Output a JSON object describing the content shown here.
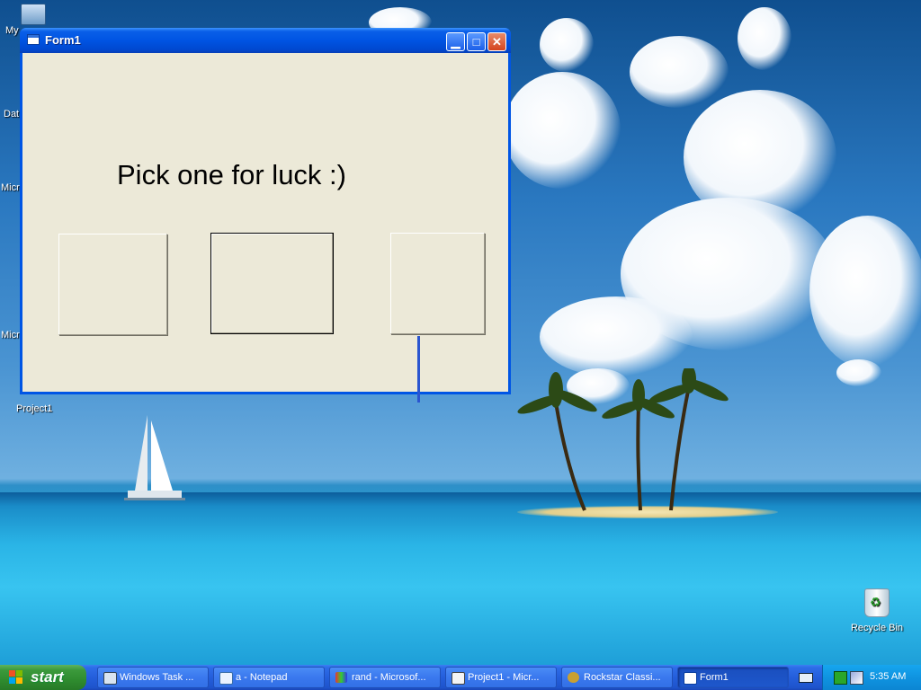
{
  "desktop": {
    "icons": [
      "My",
      "Dat",
      "Micr",
      "Micr",
      "Project1"
    ],
    "recycle_bin": "Recycle Bin"
  },
  "window": {
    "title": "Form1",
    "heading": "Pick one for luck :)"
  },
  "taskbar": {
    "start_label": "start",
    "items": [
      "Windows Task ...",
      "a - Notepad",
      "rand - Microsof...",
      "Project1 - Micr...",
      "Rockstar Classi...",
      "Form1"
    ],
    "active_item": "Form1",
    "clock": "5:35 AM"
  },
  "colors": {
    "titlebar": "#0054e3",
    "client": "#ece9d8",
    "taskbar": "#245edb",
    "start": "#3c9a3c"
  }
}
